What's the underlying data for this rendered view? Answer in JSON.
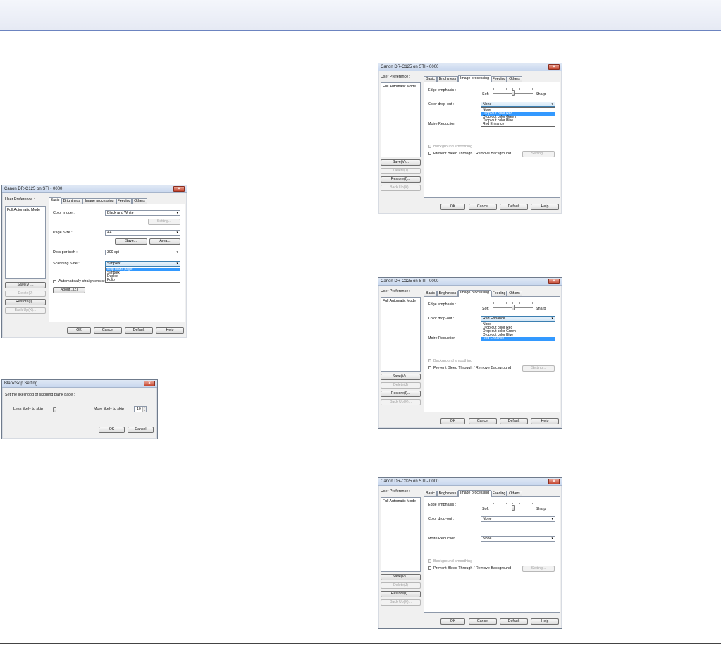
{
  "top_dialog": {
    "title": "Canon DR-C125 on STI - 0000",
    "close": "×",
    "user_preference_label": "User Preference :",
    "preference_item": "Full Automatic Mode",
    "buttons": {
      "save": "Save(V)...",
      "delete": "Delete(J)",
      "restore": "Restore(I)...",
      "backup": "Back Up(X)..."
    },
    "tabs": [
      "Basic",
      "Brightness",
      "Image processing",
      "Feeding",
      "Others"
    ],
    "active_tab": "Image processing",
    "edge_emphasis_label": "Edge emphasis :",
    "soft": "Soft",
    "sharp": "Sharp",
    "color_dropout_label": "Color drop-out :",
    "color_dropout_value": "None",
    "dropdown_items": [
      "None",
      "Drop-out color Red",
      "Drop-out color Green",
      "Drop-out color Blue",
      "Red Enhance"
    ],
    "dropdown_selected_index": 1,
    "moire_label": "Moire Reduction :",
    "background_smoothing": "Background smoothing",
    "prevent_bleed": "Prevent Bleed Through / Remove Background",
    "setting": "Setting...",
    "ok": "OK",
    "cancel": "Cancel",
    "default": "Default",
    "help": "Help"
  },
  "middle_dialog": {
    "title": "Canon DR-C125 on STI - 0000",
    "close": "×",
    "user_preference_label": "User Preference :",
    "preference_item": "Full Automatic Mode",
    "buttons": {
      "save": "Save(V)...",
      "delete": "Delete(J)",
      "restore": "Restore(I)...",
      "backup": "Back Up(X)..."
    },
    "tabs": [
      "Basic",
      "Brightness",
      "Image processing",
      "Feeding",
      "Others"
    ],
    "edge_emphasis_label": "Edge emphasis :",
    "soft": "Soft",
    "sharp": "Sharp",
    "color_dropout_label": "Color drop-out :",
    "color_dropout_value": "Red Enhance",
    "dropdown_items": [
      "None",
      "Drop-out color Red",
      "Drop-out color Green",
      "Drop-out color Blue",
      "Red Enhance"
    ],
    "dropdown_selected_index": 4,
    "moire_label": "Moire Reduction :",
    "background_smoothing": "Background smoothing",
    "prevent_bleed": "Prevent Bleed Through / Remove Background",
    "setting": "Setting...",
    "ok": "OK",
    "cancel": "Cancel",
    "default": "Default",
    "help": "Help"
  },
  "bottom_dialog": {
    "title": "Canon DR-C125 on STI - 0000",
    "close": "×",
    "user_preference_label": "User Preference :",
    "preference_item": "Full Automatic Mode",
    "buttons": {
      "save": "Save(V)...",
      "delete": "Delete(J)",
      "restore": "Restore(I)...",
      "backup": "Back Up(X)..."
    },
    "tabs": [
      "Basic",
      "Brightness",
      "Image processing",
      "Feeding",
      "Others"
    ],
    "edge_emphasis_label": "Edge emphasis :",
    "soft": "Soft",
    "sharp": "Sharp",
    "color_dropout_label": "Color drop-out :",
    "color_dropout_value": "None",
    "moire_label": "Moire Reduction :",
    "moire_value": "None",
    "background_smoothing": "Background smoothing",
    "prevent_bleed": "Prevent Bleed Through / Remove Background",
    "setting": "Setting...",
    "ok": "OK",
    "cancel": "Cancel",
    "default": "Default",
    "help": "Help"
  },
  "basic_dialog": {
    "title": "Canon DR-C125 on STI - 0000",
    "close": "×",
    "user_preference_label": "User Preference :",
    "preference_item": "Full Automatic Mode",
    "buttons": {
      "save": "Save(V)...",
      "delete": "Delete(J)",
      "restore": "Restore(I)...",
      "backup": "Back Up(X)..."
    },
    "tabs": [
      "Basic",
      "Brightness",
      "Image processing",
      "Feeding",
      "Others"
    ],
    "color_mode_label": "Color mode :",
    "color_mode_value": "Black and White",
    "setting": "Setting...",
    "page_size_label": "Page Size :",
    "page_size_value": "A4",
    "save_btn": "Save...",
    "area_btn": "Area...",
    "dpi_label": "Dots per inch :",
    "dpi_value": "300 dpi",
    "scanning_side_label": "Scanning Side :",
    "scanning_side_value": "Simplex",
    "dropdown_items": [
      "Skip blank page",
      "Simplex",
      "Duplex",
      "Folio"
    ],
    "auto_straighten": "Automatically straightens ske",
    "about": "About...(Z)",
    "ok": "OK",
    "cancel": "Cancel",
    "default": "Default",
    "help": "Help"
  },
  "blankskip_dialog": {
    "title": "BlankSkip Setting",
    "close": "×",
    "instruction": "Set the likelihood of skipping blank page :",
    "less": "Less likely to skip",
    "more": "More likely to skip",
    "value": "10",
    "ok": "OK",
    "cancel": "Cancel"
  }
}
